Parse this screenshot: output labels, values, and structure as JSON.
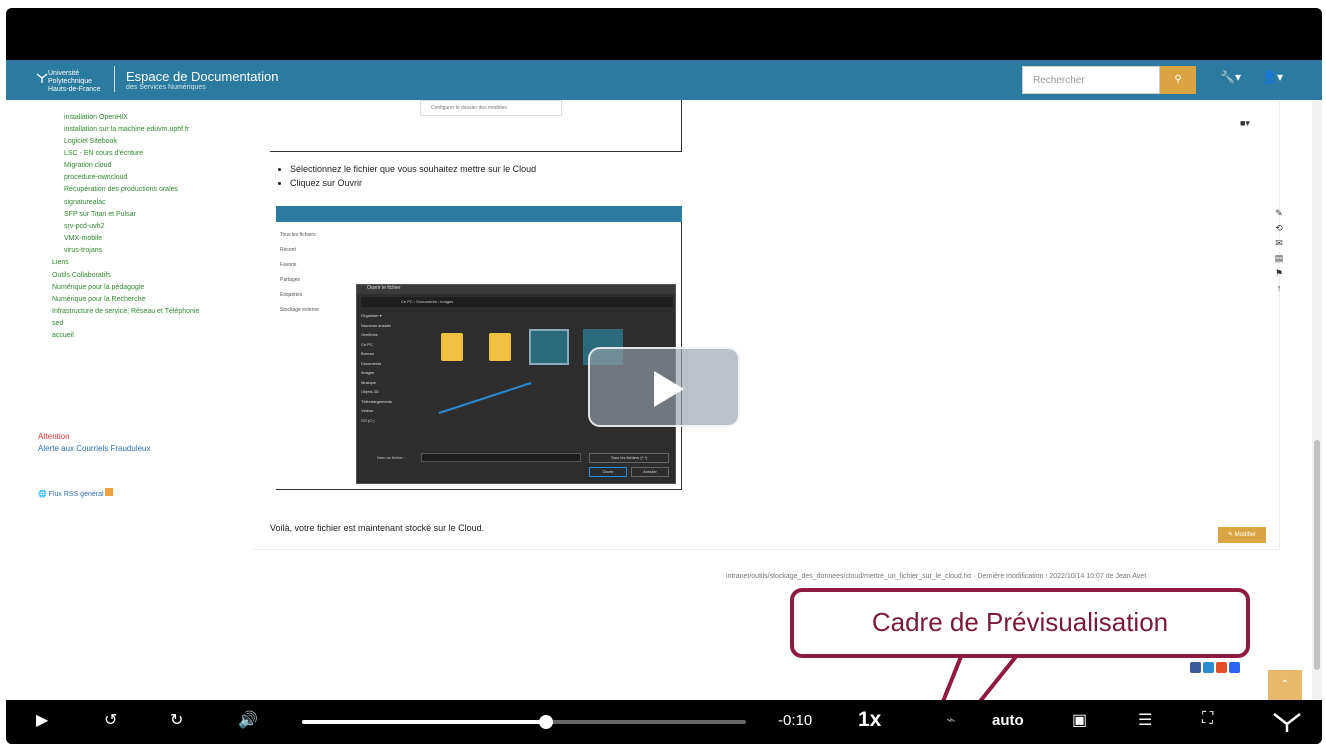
{
  "header": {
    "logo_line1": "Université",
    "logo_line2": "Polytechnique",
    "logo_line3": "Hauts-de-France",
    "title": "Espace de Documentation",
    "subtitle": "des Services Numériques",
    "search_placeholder": "Rechercher",
    "accent": "#2b7aa0"
  },
  "sidebar": {
    "items": [
      "installation OpenHIX",
      "installation sur la machine eduvm.uphf.fr",
      "Logiciel Sitebook",
      "LSC - EN cours d'écriture",
      "Migration cloud",
      "procedure-owncloud",
      "Récupération des productions orales",
      "signaturealac",
      "SFP sur Titan et Pulsar",
      "srv-pcd-uvh2",
      "VMX-mobile",
      "virus-trojans",
      "Liens",
      "Outils Collaboratifs",
      "Numérique pour la pédagogie",
      "Numérique pour la Recherche",
      "Infrastructure de service, Réseau et Téléphonie",
      "sed",
      "accueil"
    ],
    "attention_title": "Attention",
    "attention_link": "Alerte aux Courriels Frauduleux",
    "rss": "Flux RSS général"
  },
  "content": {
    "top_image_button": "Configurer le dossier des modèles",
    "bullets": [
      "Sélectionnez le fichier que vous souhaitez mettre sur le Cloud",
      "Cliquez sur Ouvrir"
    ],
    "screenshot": {
      "side_items": [
        "Tous les fichiers",
        "Récent",
        "Favoris",
        "Partages",
        "Étiquettes",
        "Stockage externe"
      ],
      "dialog_title": "Ouvrir le fichier",
      "dialog_path": "Ce PC  ›  Documents  ›  Images",
      "tree": [
        "Organiser ▾",
        "Nouveau dossier",
        "OneDrive",
        "Ce PC",
        "Bureau",
        "Documents",
        "Images",
        "Musique",
        "Objets 3D",
        "Téléchargements",
        "Vidéos",
        "OS (C:)"
      ],
      "filename_label": "Nom du fichier :",
      "filetype": "Tous les fichiers (*.*)",
      "open_button": "Ouvrir",
      "cancel_button": "Annuler"
    },
    "final_text": "Voilà, votre fichier est maintenant stocké sur le Cloud.",
    "edit_button": "Modifier",
    "meta": "intranet/outils/stockage_des_donnees/cloud/mettre_un_fichier_sur_le_cloud.txt · Dernière modification : 2022/10/14 10:07 de Jean Avet"
  },
  "callout": {
    "text": "Cadre de Prévisualisation",
    "border_color": "#8e1a44"
  },
  "player": {
    "time": "-0:10",
    "speed": "1x",
    "quality": "auto",
    "progress": 0.55
  }
}
